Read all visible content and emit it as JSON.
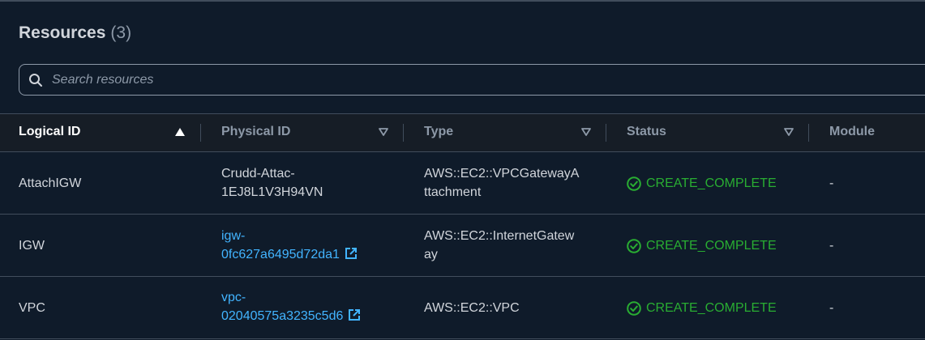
{
  "panel": {
    "title": "Resources",
    "count": "(3)"
  },
  "search": {
    "placeholder": "Search resources"
  },
  "columns": [
    {
      "label": "Logical ID",
      "sort": "ascending"
    },
    {
      "label": "Physical ID",
      "sort": "none"
    },
    {
      "label": "Type",
      "sort": "none"
    },
    {
      "label": "Status",
      "sort": "none"
    },
    {
      "label": "Module",
      "sort": "none"
    }
  ],
  "rows": [
    {
      "logical_id": "AttachIGW",
      "physical_id_line1": "Crudd-Attac-",
      "physical_id_line2": "1EJ8L1V3H94VN",
      "physical_id_is_link": false,
      "type_line1": "AWS::EC2::VPCGatewayA",
      "type_line2": "ttachment",
      "status": "CREATE_COMPLETE",
      "module": "-"
    },
    {
      "logical_id": "IGW",
      "physical_id_line1": "igw-",
      "physical_id_line2": "0fc627a6495d72da1",
      "physical_id_is_link": true,
      "type_line1": "AWS::EC2::InternetGatew",
      "type_line2": "ay",
      "status": "CREATE_COMPLETE",
      "module": "-"
    },
    {
      "logical_id": "VPC",
      "physical_id_line1": "vpc-",
      "physical_id_line2": "02040575a3235c5d6",
      "physical_id_is_link": true,
      "type_line1": "AWS::EC2::VPC",
      "type_line2": "",
      "status": "CREATE_COMPLETE",
      "module": "-"
    }
  ],
  "colors": {
    "background": "#0f1b2a",
    "header_background": "#161d26",
    "link": "#42b4ff",
    "success": "#29ad32",
    "border": "#414d5c",
    "muted_text": "#8d99a8"
  },
  "icons": {
    "search": "search-icon",
    "sort_ascending": "caret-up-filled-icon",
    "sort_none": "caret-down-outline-icon",
    "external_link": "external-link-icon",
    "status_success": "check-circle-icon"
  }
}
